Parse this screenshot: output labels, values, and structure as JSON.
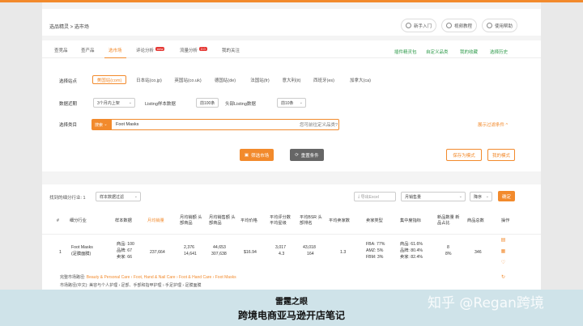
{
  "header": {
    "breadcrumb": "选品精灵 > 选市场",
    "buttons": [
      "新手入门",
      "视频教程",
      "使用帮助"
    ]
  },
  "tabs": [
    {
      "label": "查竞品",
      "active": false
    },
    {
      "label": "查产品",
      "active": false
    },
    {
      "label": "选市场",
      "active": true
    },
    {
      "label": "评论分析",
      "badge": "new",
      "active": false
    },
    {
      "label": "流量分析",
      "badge": "2.0",
      "active": false
    },
    {
      "label": "我的关注",
      "active": false
    }
  ],
  "right_links": [
    "插件精灵包",
    "自定义品类",
    "我的收藏",
    "选择历史"
  ],
  "filter": {
    "site_label": "选择站点",
    "sites": [
      "美国站(com)",
      "日本站(co.jp)",
      "英国站(co.uk)",
      "德国站(de)",
      "法国站(fr)",
      "意大利(it)",
      "西班牙(es)",
      "加拿大(ca)"
    ],
    "active_site": "美国站(com)",
    "data_label": "数据近期",
    "period": "3个月内上架",
    "listing_sample_label": "Listing样本数据",
    "listing_sample": "前100条",
    "head_listing_label": "头部Listing数据",
    "head_listing": "前10条",
    "category_label": "选择类目",
    "category_select": "搜索",
    "keyword": "Foot Masks",
    "custom_hint": "您可前往定义品类?",
    "advanced": "展示过滤条件",
    "advanced_chevron": "^",
    "filter_button": "筛选市场",
    "reset_button": "重置条件",
    "save_button": "保存为模式",
    "my_modes_button": "我的模式"
  },
  "results": {
    "count_label": "找到的细分行业: 1",
    "sort_select": "样本数据过滤",
    "export": "导出Excel",
    "month_select": "月销售量",
    "page_select": "降序",
    "confirm": "确定",
    "columns": [
      "#",
      "细分行业",
      "样本数据",
      "月均销量",
      "月均销额 头部商品",
      "月均销售额 头部商品",
      "平均价格",
      "平均评分数 平均星级",
      "平均BSR 头部排名",
      "平均卖家数",
      "卖家类型",
      "集中度指标",
      "新品数量 新品占比",
      "商品总数",
      "操作"
    ],
    "row": {
      "index": "1",
      "market_name": "Foot Masks",
      "market_tag": "(足膜面膜)",
      "sample": [
        "商品: 100",
        "品牌: 67",
        "卖家: 66"
      ],
      "monthly_sales": "237,664",
      "monthly_units": "2,376",
      "monthly_units_sub": "14,641",
      "monthly_revenue": "44,653",
      "monthly_revenue_sub": "307,638",
      "avg_price": "$16.94",
      "avg_reviews": "3,017",
      "avg_stars": "4.3",
      "avg_bsr": "43,018",
      "avg_bsr_sub": "164",
      "sellers": "1.3",
      "seller_types": [
        "FBA: 77%",
        "AMZ: 5%",
        "FBM: 3%"
      ],
      "concentration": [
        "商品: 61.6%",
        "品牌: 80.4%",
        "卖家: 82.4%"
      ],
      "new_count": "8",
      "new_ratio": "8%",
      "total": "346"
    },
    "category_path_label": "完整市场路径:",
    "category_path": "Beauty & Personal Care › Foot, Hand & Nail Care › Foot & Hand Care › Foot Masks",
    "category_cn": "市场路径(中文): 美容与个人护理 › 足部、手部和指甲护理 › 手足护理 › 足膜面膜"
  },
  "banner": {
    "line1": "雷霆之眼",
    "line2": "跨境电商亚马逊开店笔记",
    "watermark": "知乎 @Regan跨境"
  }
}
